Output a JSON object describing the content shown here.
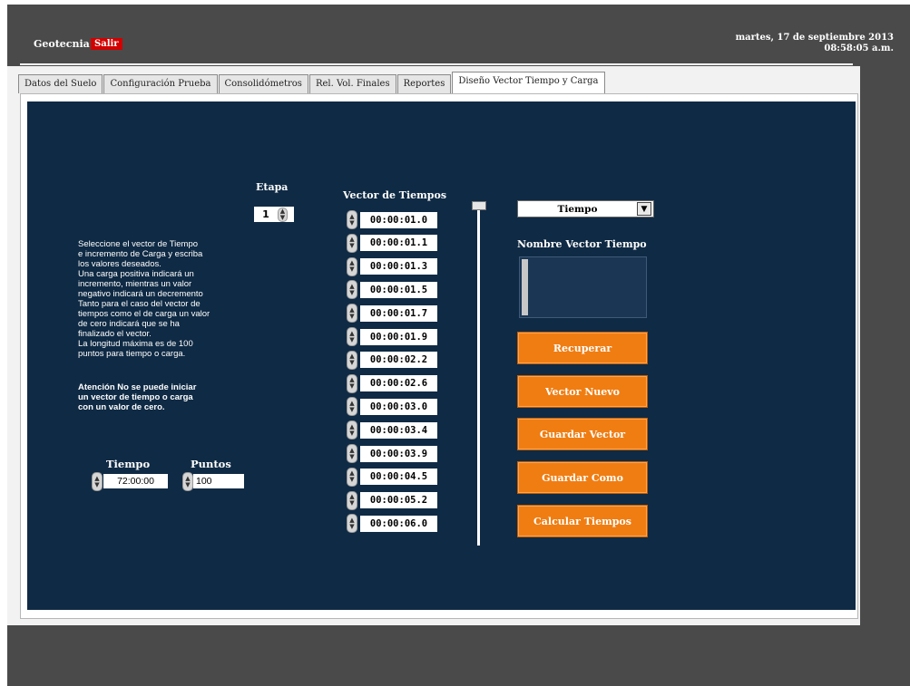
{
  "header": {
    "app_name": "Geotecnia",
    "exit_label": "Salir",
    "date": "martes, 17 de septiembre 2013",
    "time": "08:58:05 a.m."
  },
  "tabs": [
    {
      "label": "Datos del Suelo"
    },
    {
      "label": "Configuración Prueba"
    },
    {
      "label": "Consolidómetros"
    },
    {
      "label": "Rel. Vol. Finales"
    },
    {
      "label": "Reportes"
    },
    {
      "label": "Diseño Vector Tiempo y Carga"
    }
  ],
  "active_tab_index": 5,
  "etapa": {
    "label": "Etapa",
    "value": "1"
  },
  "instructions": "Seleccione el vector de Tiempo\ne incremento de Carga y escriba\nlos valores deseados.\nUna carga positiva indicará un\nincremento, mientras un valor\nnegativo indicará un decremento\nTanto para el caso del vector de\ntiempos como el de carga un valor\nde cero indicará que se ha\nfinalizado el vector.\nLa longitud máxima es de 100\npuntos para tiempo o carga.",
  "warning": "Atención No se puede iniciar\nun vector de tiempo o carga\ncon un valor de cero.",
  "tiempo": {
    "label": "Tiempo",
    "value": "72:00:00"
  },
  "puntos": {
    "label": "Puntos",
    "value": "100"
  },
  "vector": {
    "label": "Vector de Tiempos",
    "values": [
      "00:00:01.0",
      "00:00:01.1",
      "00:00:01.3",
      "00:00:01.5",
      "00:00:01.7",
      "00:00:01.9",
      "00:00:02.2",
      "00:00:02.6",
      "00:00:03.0",
      "00:00:03.4",
      "00:00:03.9",
      "00:00:04.5",
      "00:00:05.2",
      "00:00:06.0"
    ]
  },
  "selector": {
    "value": "Tiempo"
  },
  "name_box": {
    "label": "Nombre Vector Tiempo"
  },
  "buttons": {
    "recuperar": "Recuperar",
    "nuevo": "Vector Nuevo",
    "guardar": "Guardar Vector",
    "guardar_como": "Guardar Como",
    "calcular": "Calcular Tiempos"
  },
  "colors": {
    "panel": "#0f2a44",
    "button": "#f07d12",
    "exit": "#d20000"
  }
}
